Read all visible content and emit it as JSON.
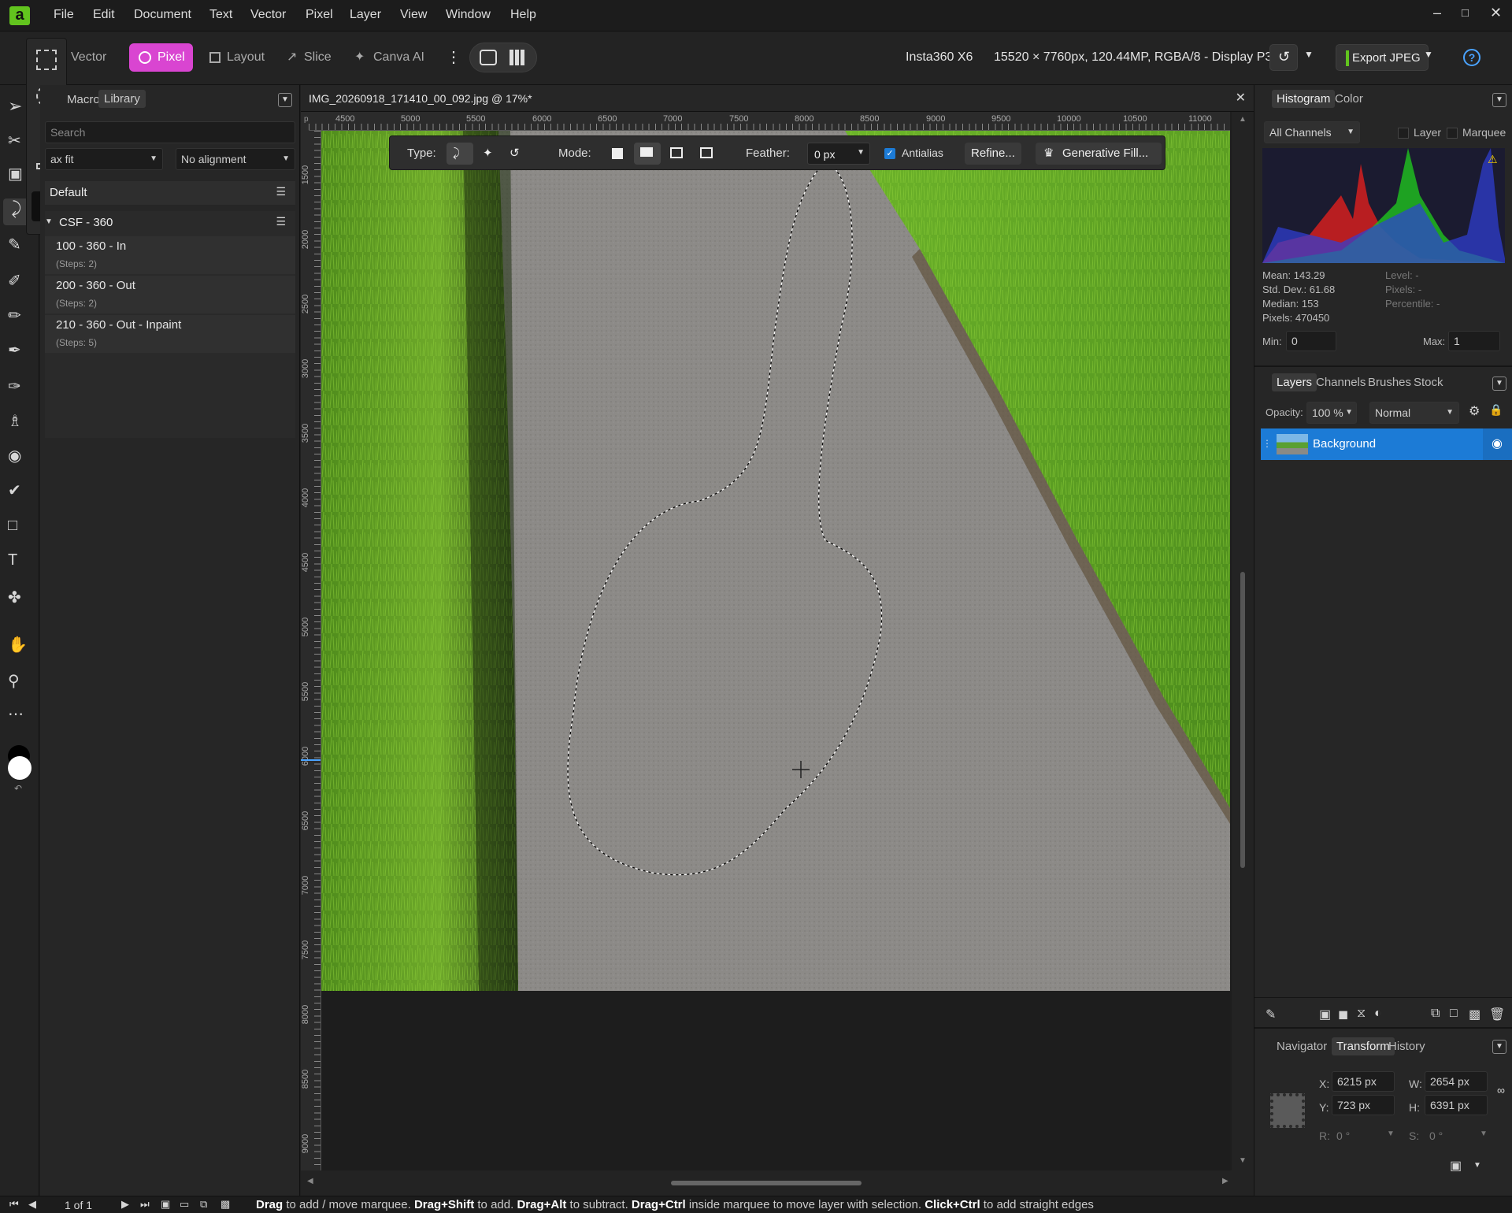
{
  "menu": [
    "File",
    "Edit",
    "Document",
    "Text",
    "Vector",
    "Pixel",
    "Layer",
    "View",
    "Window",
    "Help"
  ],
  "toolbar": {
    "personas": [
      "Vector",
      "Pixel",
      "Layout",
      "Slice",
      "Canva AI"
    ],
    "camera": "Insta360 X6",
    "doc_info": "15520 × 7760px, 120.44MP, RGBA/8 - Display P3",
    "export_label": "Export JPEG"
  },
  "library": {
    "tabs": [
      "Macro",
      "Library"
    ],
    "search_placeholder": "Search",
    "fit": "ax fit",
    "alignment": "No alignment",
    "sections": [
      "Default",
      "CSF - 360"
    ],
    "items": [
      {
        "label": "100 - 360 - In",
        "steps": "(Steps: 2)"
      },
      {
        "label": "200 - 360 - Out",
        "steps": "(Steps: 2)"
      },
      {
        "label": "210 - 360 - Out - Inpaint",
        "steps": "(Steps: 5)"
      }
    ]
  },
  "document": {
    "tab_title": "IMG_20260918_171410_00_092.jpg @ 17%*",
    "ruler_h": [
      "4500",
      "5000",
      "5500",
      "6000",
      "6500",
      "7000",
      "7500",
      "8000",
      "8500",
      "9000",
      "9500",
      "10000",
      "10500",
      "11000"
    ],
    "ruler_v": [
      "1500",
      "2000",
      "2500",
      "3000",
      "3500",
      "4000",
      "4500",
      "5000",
      "5500",
      "6000",
      "6500",
      "7000",
      "7500",
      "8000",
      "8500",
      "9000"
    ]
  },
  "context_toolbar": {
    "type_label": "Type:",
    "mode_label": "Mode:",
    "feather_label": "Feather:",
    "feather_value": "0 px",
    "antialias_label": "Antialias",
    "refine_label": "Refine...",
    "generative_label": "Generative Fill..."
  },
  "histogram": {
    "tabs": [
      "Histogram",
      "Color"
    ],
    "channel": "All Channels",
    "layer_label": "Layer",
    "marquee_label": "Marquee",
    "mean": "Mean: 143.29",
    "stddev": "Std. Dev.: 61.68",
    "median": "Median: 153",
    "pixels": "Pixels: 470450",
    "level": "Level: -",
    "pixels_right": "Pixels: -",
    "percentile": "Percentile: -",
    "min_label": "Min:",
    "min_value": "0",
    "max_label": "Max:",
    "max_value": "1"
  },
  "layers": {
    "tabs": [
      "Layers",
      "Channels",
      "Brushes",
      "Stock"
    ],
    "opacity_label": "Opacity:",
    "opacity_value": "100 %",
    "blend": "Normal",
    "layer_name": "Background"
  },
  "transform": {
    "tabs": [
      "Navigator",
      "Transform",
      "History"
    ],
    "x_label": "X:",
    "x": "6215 px",
    "y_label": "Y:",
    "y": "723 px",
    "w_label": "W:",
    "w": "2654 px",
    "h_label": "H:",
    "h": "6391 px",
    "r_label": "R:",
    "r": "0 °",
    "s_label": "S:",
    "s": "0 °"
  },
  "status": {
    "page": "1 of 1",
    "hint": [
      {
        "b": "Drag",
        "t": " to add / move marquee. "
      },
      {
        "b": "Drag+Shift",
        "t": " to add. "
      },
      {
        "b": "Drag+Alt",
        "t": " to subtract. "
      },
      {
        "b": "Drag+Ctrl",
        "t": " inside marquee to move layer with selection. "
      },
      {
        "b": "Click+Ctrl",
        "t": " to add straight edges"
      }
    ]
  },
  "colors": {
    "accent": "#1c7bd6",
    "pixel_persona": "#d945d1",
    "brand": "#62c41e",
    "grass": "#4f8f1d",
    "asphalt": "#8d8b88"
  }
}
